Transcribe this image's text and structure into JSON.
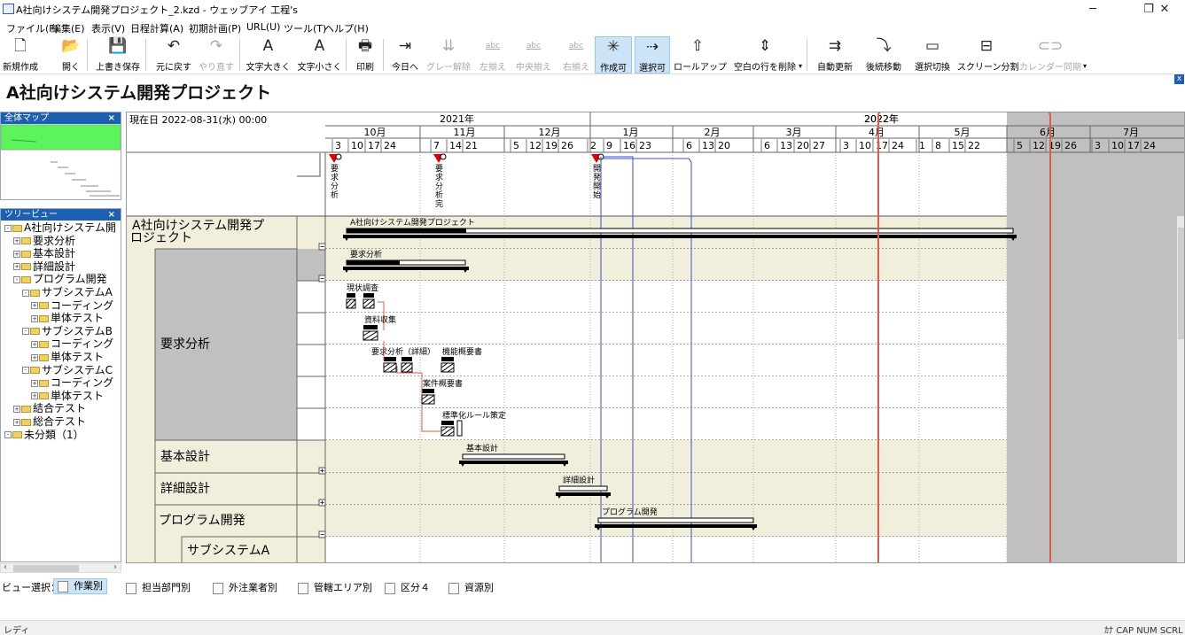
{
  "window": {
    "title": "A社向けシステム開発プロジェクト_2.kzd - ウェッブアイ 工程's",
    "minimize": "─",
    "maximize": "❐",
    "close": "✕"
  },
  "menu": [
    "ファイル(F)",
    "編集(E)",
    "表示(V)",
    "日程計算(A)",
    "初期計画(P)",
    "URL(U)",
    "ツール(T)",
    "ヘルプ(H)"
  ],
  "toolbar": [
    {
      "label": "新規作成",
      "icon": "new-document-icon",
      "glyph": "🗋"
    },
    {
      "label": "開く",
      "icon": "open-folder-icon",
      "glyph": "📂"
    },
    {
      "label": "上書き保存",
      "icon": "save-icon",
      "glyph": "💾"
    },
    {
      "label": "元に戻す",
      "icon": "undo-icon",
      "glyph": "↶"
    },
    {
      "label": "やり直す",
      "icon": "redo-icon",
      "glyph": "↷"
    },
    {
      "label": "文字大きく",
      "icon": "font-larger-icon",
      "glyph": "A"
    },
    {
      "label": "文字小さく",
      "icon": "font-smaller-icon",
      "glyph": "A"
    },
    {
      "label": "印刷",
      "icon": "print-icon",
      "glyph": "🖶"
    },
    {
      "label": "今日へ",
      "icon": "today-icon",
      "glyph": "⇥"
    },
    {
      "label": "グレー解除",
      "icon": "gray-clear-icon",
      "glyph": "⇊"
    },
    {
      "label": "左揃え",
      "icon": "align-left-icon",
      "glyph": "abc"
    },
    {
      "label": "中央揃え",
      "icon": "align-center-icon",
      "glyph": "abc"
    },
    {
      "label": "右揃え",
      "icon": "align-right-icon",
      "glyph": "abc"
    },
    {
      "label": "作成可",
      "icon": "create-enabled-icon",
      "glyph": "✳"
    },
    {
      "label": "選択可",
      "icon": "select-enabled-icon",
      "glyph": "⇢"
    },
    {
      "label": "ロールアップ",
      "icon": "rollup-icon",
      "glyph": "⇧"
    },
    {
      "label": "空白の行を削除",
      "icon": "delete-empty-rows-icon",
      "glyph": "⇕"
    },
    {
      "label": "自動更新",
      "icon": "auto-update-icon",
      "glyph": "⇉"
    },
    {
      "label": "後続移動",
      "icon": "move-successor-icon",
      "glyph": "⤵"
    },
    {
      "label": "選択切換",
      "icon": "toggle-selection-icon",
      "glyph": "▭"
    },
    {
      "label": "スクリーン分割",
      "icon": "split-screen-icon",
      "glyph": "⊟"
    },
    {
      "label": "カレンダー同期",
      "icon": "calendar-sync-icon",
      "glyph": "⊂⊃"
    }
  ],
  "document_title": "A社向けシステム開発プロジェクト",
  "panels": {
    "map_title": "全体マップ",
    "tree_title": "ツリービュー",
    "close_glyph": "×",
    "tree": [
      {
        "label": "A社向けシステム開",
        "level": 0,
        "exp": "-"
      },
      {
        "label": "要求分析",
        "level": 1,
        "exp": "+"
      },
      {
        "label": "基本設計",
        "level": 1,
        "exp": "+"
      },
      {
        "label": "詳細設計",
        "level": 1,
        "exp": "+"
      },
      {
        "label": "プログラム開発",
        "level": 1,
        "exp": "-"
      },
      {
        "label": "サブシステムA",
        "level": 2,
        "exp": "-"
      },
      {
        "label": "コーディング",
        "level": 3,
        "exp": "+"
      },
      {
        "label": "単体テスト",
        "level": 3,
        "exp": "+"
      },
      {
        "label": "サブシステムB",
        "level": 2,
        "exp": "-"
      },
      {
        "label": "コーディング",
        "level": 3,
        "exp": "+"
      },
      {
        "label": "単体テスト",
        "level": 3,
        "exp": "+"
      },
      {
        "label": "サブシステムC",
        "level": 2,
        "exp": "-"
      },
      {
        "label": "コーディング",
        "level": 3,
        "exp": "+"
      },
      {
        "label": "単体テスト",
        "level": 3,
        "exp": "+"
      },
      {
        "label": "結合テスト",
        "level": 1,
        "exp": "+"
      },
      {
        "label": "総合テスト",
        "level": 1,
        "exp": "+"
      },
      {
        "label": "未分類（1）",
        "level": 0,
        "exp": "-"
      }
    ]
  },
  "gantt": {
    "current_date": "現在日 2022-08-31(水) 00:00",
    "years": [
      "2021年",
      "2022年"
    ],
    "months": [
      "10月",
      "11月",
      "12月",
      "1月",
      "2月",
      "3月",
      "4月",
      "5月",
      "6月",
      "7月"
    ],
    "days": [
      "3",
      "10",
      "17",
      "24",
      "7",
      "14",
      "21",
      "5",
      "12",
      "19",
      "26",
      "2",
      "9",
      "16",
      "23",
      "6",
      "13",
      "20",
      "6",
      "13",
      "20",
      "27",
      "3",
      "10",
      "17",
      "24",
      "1",
      "8",
      "15",
      "22",
      "5",
      "12",
      "19",
      "26",
      "3",
      "10",
      "17",
      "24"
    ],
    "milestones": [
      "要求分析",
      "要求分析完",
      "開発開始"
    ],
    "task_names": {
      "root": "A社向けシステム開発プロジェクト",
      "req": "要求分析",
      "basic": "基本設計",
      "detail": "詳細設計",
      "prog": "プログラム開発",
      "subA": "サブシステムA"
    },
    "bar_labels": {
      "root": "A社向けシステム開発プロジェクト",
      "req": "要求分析",
      "genjo": "現状調査",
      "shiryo": "資料収集",
      "youkyu_shosai": "要求分析（詳細）",
      "kino": "機能概要書",
      "anken": "案件概要書",
      "hyojun": "標準化ルール策定",
      "basic": "基本設計",
      "detail": "詳細設計",
      "prog": "プログラム開発"
    },
    "colors": {
      "group_bg": "#f1efdc",
      "selection_gray": "#c0c0c0",
      "highlight_red": "#e05a45",
      "link_blue": "#3a4fd6",
      "milestone_red": "#e00000"
    }
  },
  "view_tabs": {
    "prefix": "ビュー選択：",
    "tabs": [
      "作業別",
      "担当部門別",
      "外注業者別",
      "管轄エリア別",
      "区分４",
      "資源別"
    ]
  },
  "status": {
    "left": "レディ",
    "right": "ｶﾅ CAP NUM SCRL"
  }
}
